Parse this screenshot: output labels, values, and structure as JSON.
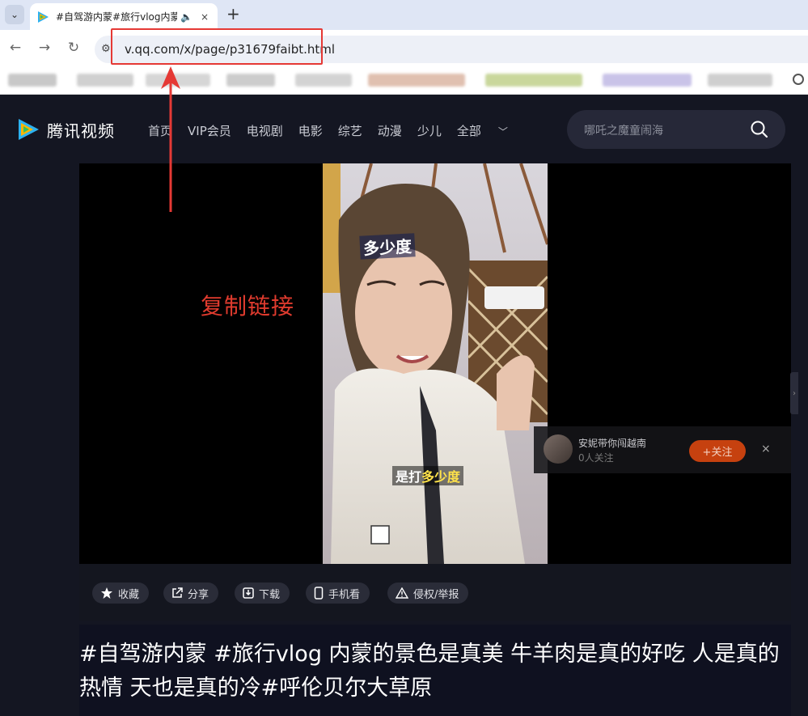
{
  "browser": {
    "tab": {
      "title": "#自驾游内蒙#旅行vlog内蒙",
      "close": "×"
    },
    "new_tab": "+",
    "url": "v.qq.com/x/page/p31679faibt.html"
  },
  "site": {
    "logo_text": "腾讯视频",
    "nav": [
      "首页",
      "VIP会员",
      "电视剧",
      "电影",
      "综艺",
      "动漫",
      "少儿",
      "全部"
    ],
    "search_placeholder": "哪吒之魔童闹海"
  },
  "annotation": "复制链接",
  "video": {
    "caption_top": "多少度",
    "caption_bottom_prefix": "是打",
    "caption_bottom_highlight": "多少度"
  },
  "follow": {
    "name": "安妮带你闯越南",
    "count": "0人关注",
    "button": "+关注",
    "close": "×"
  },
  "actions": [
    "收藏",
    "分享",
    "下载",
    "手机看",
    "侵权/举报"
  ],
  "video_title": "#自驾游内蒙 #旅行vlog 内蒙的景色是真美 牛羊肉是真的好吃 人是真的热情 天也是真的冷#呼伦贝尔大草原",
  "colors": {
    "accent": "#e53935",
    "follow": "#c6410f",
    "site_bg": "#141622"
  }
}
